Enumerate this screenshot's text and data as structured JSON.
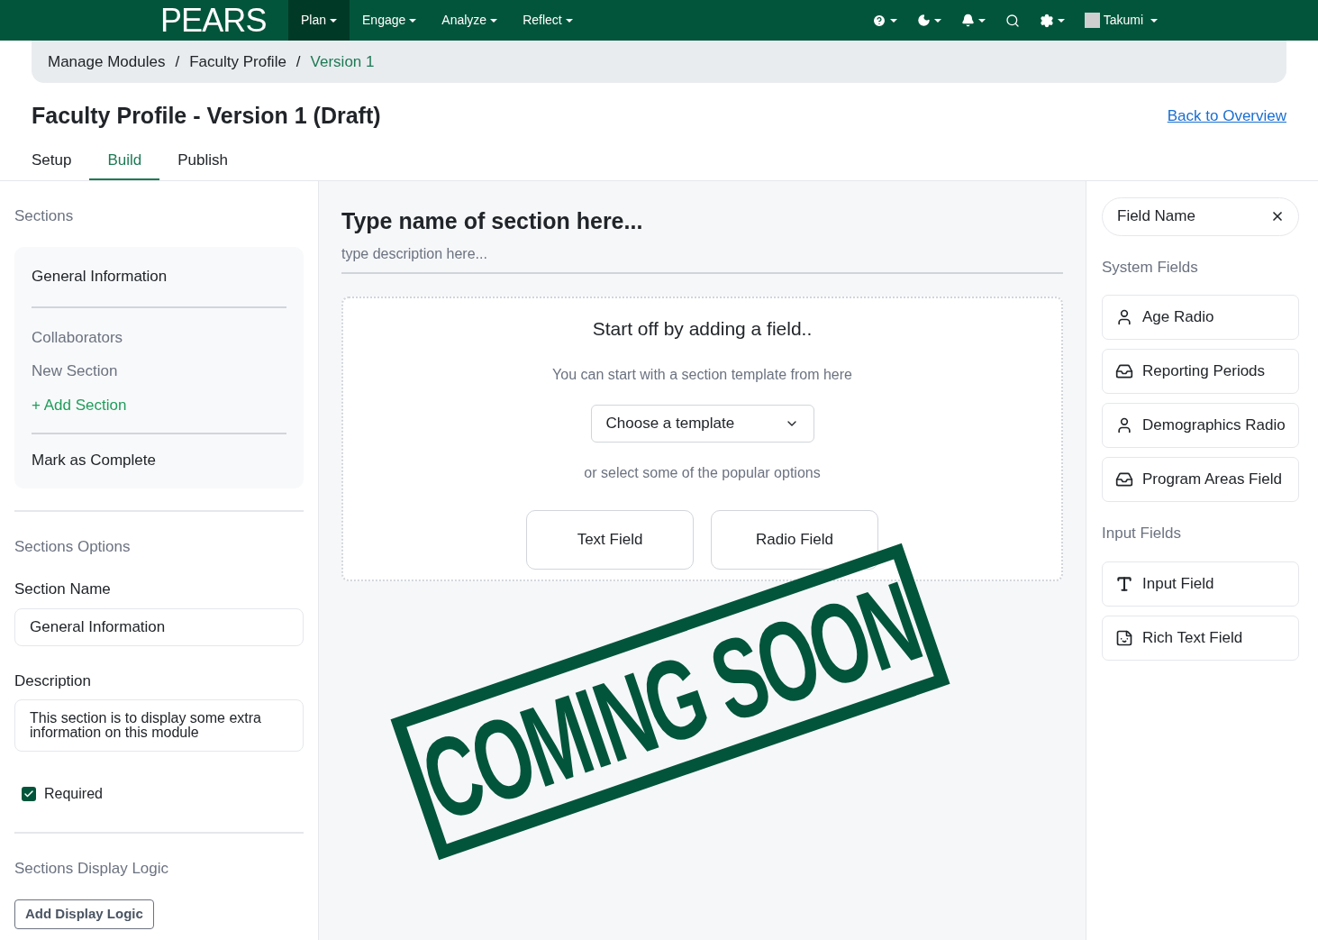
{
  "top_bar": {
    "logo": "PEARS",
    "menus": [
      {
        "label": "Plan",
        "selected": true
      },
      {
        "label": "Engage",
        "selected": false
      },
      {
        "label": "Analyze",
        "selected": false
      },
      {
        "label": "Reflect",
        "selected": false
      }
    ],
    "user": "Takumi"
  },
  "breadcrumb": [
    {
      "label": "Manage Modules",
      "current": false
    },
    {
      "label": "Faculty Profile",
      "current": false
    },
    {
      "label": "Version 1",
      "current": true
    }
  ],
  "breadcrumb_separators": [
    "/",
    "/"
  ],
  "page": {
    "title": "Faculty Profile - Version 1 (Draft)",
    "back_link": "Back to Overview"
  },
  "tabs": [
    {
      "label": "Setup",
      "selected": false
    },
    {
      "label": "Build",
      "selected": true
    },
    {
      "label": "Publish",
      "selected": false
    }
  ],
  "sections_panel": {
    "heading": "Sections",
    "items": [
      {
        "label": "General Information",
        "selected": true
      },
      {
        "label": "Collaborators",
        "selected": false
      },
      {
        "label": "New Section",
        "selected": false
      }
    ],
    "add_label": "+ Add Section",
    "complete_label": "Mark as Complete"
  },
  "section_options": {
    "heading": "Sections Options",
    "name_label": "Section Name",
    "name_value": "General Information",
    "description_label": "Description",
    "description_value": "This section is to display some extra information on this module",
    "required_label": "Required",
    "required": true
  },
  "display_logic": {
    "heading": "Sections Display Logic",
    "button": "Add Display Logic"
  },
  "canvas": {
    "section_title_placeholder": "Type name of section here...",
    "section_description_placeholder": "type description here...",
    "empty_title": "Start off by adding a field..",
    "template_hint": "You can start with a section template from here",
    "template_select": "Choose a template",
    "popular_hint": "or select some of the popular options",
    "options": [
      "Text Field",
      "Radio Field"
    ]
  },
  "stamp": "COMING SOON",
  "field_panel": {
    "search_placeholder": "Field Name",
    "groups": [
      {
        "heading": "System Fields",
        "fields": [
          {
            "label": "Age Radio",
            "kind": "person"
          },
          {
            "label": "Reporting Periods",
            "kind": "inbox"
          },
          {
            "label": "Demographics Radio",
            "kind": "person"
          },
          {
            "label": "Program Areas Field",
            "kind": "inbox"
          }
        ]
      },
      {
        "heading": "Input Fields",
        "fields": [
          {
            "label": "Input Field",
            "kind": "text"
          },
          {
            "label": "Rich Text Field",
            "kind": "sticker"
          }
        ]
      }
    ]
  }
}
